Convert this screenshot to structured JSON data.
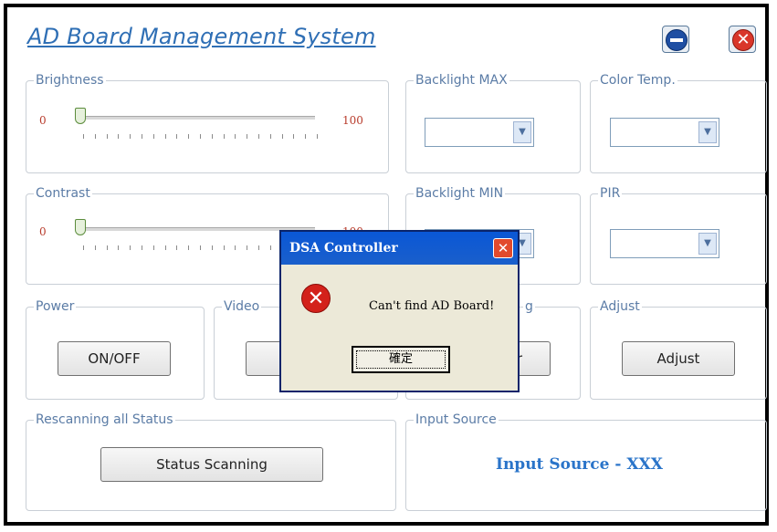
{
  "app": {
    "title": "AD Board Management System"
  },
  "window_controls": {
    "minimize_icon": "minimize-circle-icon",
    "close_icon": "close-circle-icon"
  },
  "brightness": {
    "label": "Brightness",
    "min": "0",
    "max": "100",
    "value": 0
  },
  "contrast": {
    "label": "Contrast",
    "min": "0",
    "max": "100",
    "value": 0
  },
  "backlight_max": {
    "label": "Backlight MAX",
    "value": ""
  },
  "backlight_min": {
    "label": "Backlight MIN",
    "value": ""
  },
  "color_temp": {
    "label": "Color Temp.",
    "value": ""
  },
  "pir": {
    "label": "PIR",
    "value": ""
  },
  "power": {
    "label": "Power",
    "button": "ON/OFF"
  },
  "video": {
    "label": "Video",
    "button": "D"
  },
  "setting": {
    "label_tail": "g",
    "button_tail": "r"
  },
  "adjust": {
    "label": "Adjust",
    "button": "Adjust"
  },
  "rescan": {
    "label": "Rescanning all Status",
    "button": "Status Scanning"
  },
  "input_source": {
    "label": "Input Source",
    "value": "Input Source - XXX"
  },
  "dialog": {
    "title": "DSA Controller",
    "message": "Can't find AD Board!",
    "ok_button": "確定",
    "icon": "error-icon"
  },
  "colors": {
    "accent": "#2f6fb5",
    "group_title": "#5b7ca6",
    "dialog_title": "#0a57d6"
  }
}
